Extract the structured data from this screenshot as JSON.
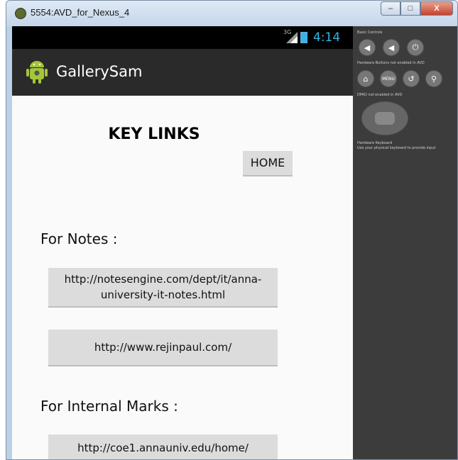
{
  "window": {
    "title": "5554:AVD_for_Nexus_4",
    "minimize_label": "–",
    "maximize_label": "□",
    "close_label": "X"
  },
  "status_bar": {
    "network": "3G",
    "time": "4:14",
    "accent": "#33b5e5"
  },
  "action_bar": {
    "app_name": "GallerySam"
  },
  "content": {
    "heading": "KEY LINKS",
    "home_button": "HOME",
    "sections": [
      {
        "label": "For Notes :",
        "links": [
          "http://notesengine.com/dept/it/anna-university-it-notes.html",
          "http://www.rejinpaul.com/"
        ]
      },
      {
        "label": "For Internal Marks :",
        "links": [
          "http://coe1.annauniv.edu/home/"
        ]
      }
    ]
  },
  "emulator_controls": {
    "basic_controls": "Basic Controls",
    "hardware_buttons": "Hardware Buttons not enabled in AVD",
    "dpad": "DPAD not enabled in AVD",
    "hardware_keyboard": "Hardware Keyboard",
    "keyboard_hint": "Use your physical keyboard to provide input",
    "menu_label": "MENU"
  }
}
